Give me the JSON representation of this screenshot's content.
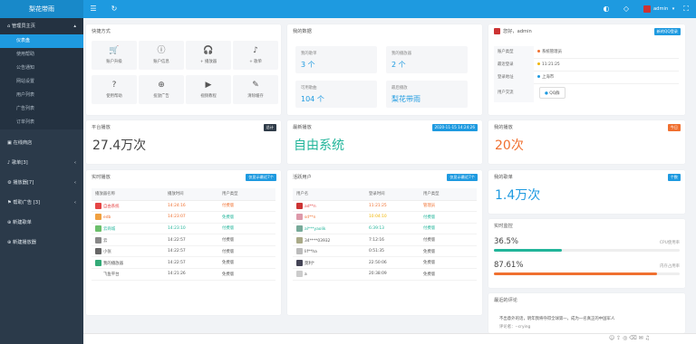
{
  "brand": "梨花带雨",
  "topbar": {
    "user": "admin"
  },
  "sidebar": {
    "groups": [
      {
        "label": "管理员主页",
        "items": [
          "仪表盘",
          "使用帮助",
          "公告通知",
          "网站设置",
          "用户列表",
          "广告列表",
          "订单列表"
        ]
      },
      {
        "label": "在线商店",
        "items": []
      },
      {
        "label": "歌单[3]",
        "items": []
      },
      {
        "label": "播放器[7]",
        "items": []
      },
      {
        "label": "帮助广告 [3]",
        "items": []
      },
      {
        "label": "新建歌单",
        "items": []
      },
      {
        "label": "新建播放器",
        "items": []
      }
    ]
  },
  "quick": {
    "title": "快捷方式",
    "items": [
      {
        "label": "账户升级",
        "icon": "cart-icon"
      },
      {
        "label": "账户信息",
        "icon": "info-icon"
      },
      {
        "label": "+ 播放器",
        "icon": "headphones-icon"
      },
      {
        "label": "+ 歌单",
        "icon": "music-note-icon"
      },
      {
        "label": "使用帮助",
        "icon": "help-doc-icon"
      },
      {
        "label": "投放广告",
        "icon": "plus-circle-icon"
      },
      {
        "label": "视频教程",
        "icon": "video-icon"
      },
      {
        "label": "清除缓存",
        "icon": "broom-icon"
      }
    ]
  },
  "mydata": {
    "title": "我的数据",
    "items": [
      {
        "label": "我的歌单",
        "value": "3 个"
      },
      {
        "label": "我的播放器",
        "value": "2 个"
      },
      {
        "label": "可用歌曲",
        "value": "104 个"
      },
      {
        "label": "最后播放",
        "value": "梨花带雨"
      }
    ]
  },
  "profile": {
    "greeting": "您好，admin",
    "badge": "新的QQ登录",
    "rows": [
      {
        "k": "账户类型",
        "v": "系统管理员",
        "color": "#f07030"
      },
      {
        "k": "最近登录",
        "v": "11:21:25",
        "color": "#f0b400"
      },
      {
        "k": "登录地址",
        "v": "上海市",
        "color": "#1e9ae0"
      },
      {
        "k": "用户交流",
        "v": "QQ群",
        "color": ""
      }
    ]
  },
  "stats": [
    {
      "title": "平台播放",
      "badge": "总计",
      "badgeColor": "#2f3b48",
      "value": "27.4万次",
      "valueColor": "#444"
    },
    {
      "title": "最新播放",
      "badge": "2020-11-15 14:24:26",
      "badgeColor": "#1e9ae0",
      "value": "自由系统",
      "valueColor": "#22b59a"
    },
    {
      "title": "我的播放",
      "badge": "今日",
      "badgeColor": "#f07030",
      "value": "20次",
      "valueColor": "#f07030"
    },
    {
      "title": "我的歌单",
      "badge": "个数",
      "badgeColor": "#1e9ae0",
      "value": "1.4万次",
      "valueColor": "#1e9ae0"
    }
  ],
  "players": {
    "title": "实时播放",
    "badge": "仅显示最近7个",
    "headers": [
      "播放器名称",
      "播放时间",
      "用户类型"
    ],
    "rows": [
      {
        "name": "自由系统",
        "time": "14:24:16",
        "type": "付费版",
        "nc": "#e54545",
        "tc": "#f07030",
        "yc": "#f07030",
        "av": "#e54545"
      },
      {
        "name": "edb",
        "time": "14:23:07",
        "type": "免费版",
        "nc": "#f07030",
        "tc": "#f07030",
        "yc": "#22b59a",
        "av": "#f0a040"
      },
      {
        "name": "云商城",
        "time": "14:23:10",
        "type": "付费版",
        "nc": "#22b59a",
        "tc": "#22b59a",
        "yc": "#22b59a",
        "av": "#6bbf6b"
      },
      {
        "name": "云",
        "time": "14:22:57",
        "type": "付费版",
        "nc": "#555",
        "tc": "#555",
        "yc": "#555",
        "av": "#888"
      },
      {
        "name": "小张",
        "time": "14:22:57",
        "type": "付费版",
        "nc": "#555",
        "tc": "#555",
        "yc": "#555",
        "av": "#666"
      },
      {
        "name": "我的播放器",
        "time": "14:22:57",
        "type": "免费版",
        "nc": "#555",
        "tc": "#555",
        "yc": "#555",
        "av": "#3a7"
      },
      {
        "name": "飞鱼平台",
        "time": "14:21:26",
        "type": "免费版",
        "nc": "#555",
        "tc": "#555",
        "yc": "#555",
        "av": ""
      }
    ]
  },
  "users": {
    "title": "活跃用户",
    "badge": "仅显示最近7个",
    "headers": [
      "用户名",
      "登录时间",
      "用户类型"
    ],
    "rows": [
      {
        "name": "ad**n",
        "time": "11:21:25",
        "type": "管理员",
        "nc": "#e54545",
        "tc": "#f07030",
        "yc": "#f07030",
        "av": "#c33"
      },
      {
        "name": "sd**n",
        "time": "10:04:10",
        "type": "付费版",
        "nc": "#f07030",
        "tc": "#f0b400",
        "yc": "#22b59a",
        "av": "#d9a"
      },
      {
        "name": "al***yaolik",
        "time": "6:39:13",
        "type": "付费版",
        "nc": "#22b59a",
        "tc": "#22b59a",
        "yc": "#22b59a",
        "av": "#7a9"
      },
      {
        "name": "34****03932",
        "time": "7:12:16",
        "type": "付费版",
        "nc": "#555",
        "tc": "#555",
        "yc": "#555",
        "av": "#aa8"
      },
      {
        "name": "lif**ha",
        "time": "0:51:35",
        "type": "免费版",
        "nc": "#555",
        "tc": "#555",
        "yc": "#555",
        "av": "#bbb"
      },
      {
        "name": "莫利*",
        "time": "22:50:06",
        "type": "免费版",
        "nc": "#555",
        "tc": "#555",
        "yc": "#555",
        "av": "#445"
      },
      {
        "name": "a",
        "time": "20:38:09",
        "type": "免费版",
        "nc": "#555",
        "tc": "#555",
        "yc": "#555",
        "av": "#ccc"
      }
    ]
  },
  "monitor": {
    "title": "实时监控",
    "items": [
      {
        "value": "36.5%",
        "label": "CPU使用率",
        "pct": 36.5,
        "color": "#22b59a"
      },
      {
        "value": "87.61%",
        "label": "内存占用率",
        "pct": 87.61,
        "color": "#f07030"
      }
    ]
  },
  "quote": {
    "title": "最近的评论",
    "text": "不出意外的话，明年我将夺得全球第一，成为一名真正的中国军人",
    "author": "评论者：--crying"
  }
}
